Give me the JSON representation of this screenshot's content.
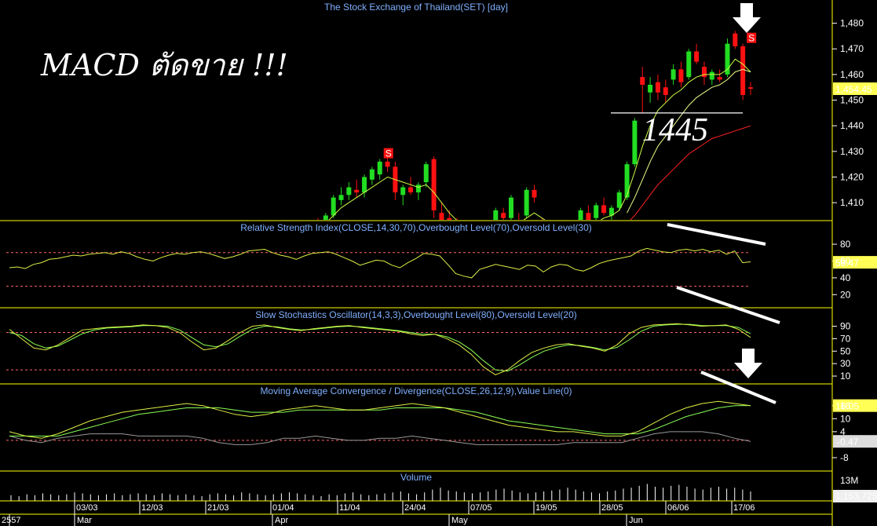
{
  "annotations": {
    "headline": "MACD ตัดขาย !!!",
    "support_label": "1445",
    "sell_marker": "S"
  },
  "colors": {
    "up": "#22dd22",
    "down": "#ff1111",
    "ma_fast": "#ccff44",
    "ma_slow": "#ff2222",
    "osc_main": "#ddee44",
    "osc_signal": "#88ff55",
    "macd_hist": "#999999",
    "level_line": "#ff6666",
    "panel_border": "#ffff00",
    "title": "#7fb0ff",
    "last_value_bg": "#ffff55"
  },
  "chart_data": [
    {
      "type": "candlestick",
      "title": "The Stock Exchange of Thailand(SET) [day]",
      "ylim": [
        1403,
        1486
      ],
      "yticks": [
        1410,
        1420,
        1430,
        1440,
        1450,
        1460,
        1470,
        1480
      ],
      "last_value": "1,454.45",
      "dates": [
        "03/03",
        "12/03",
        "21/03",
        "01/04",
        "11/04",
        "24/04",
        "07/05",
        "19/05",
        "28/05",
        "06/06",
        "17/06"
      ],
      "candles": [
        {
          "o": 1402,
          "h": 1404,
          "l": 1400,
          "c": 1401
        },
        {
          "o": 1403,
          "h": 1406,
          "l": 1401,
          "c": 1405
        },
        {
          "o": 1405,
          "h": 1413,
          "l": 1404,
          "c": 1412
        },
        {
          "o": 1411,
          "h": 1416,
          "l": 1409,
          "c": 1413
        },
        {
          "o": 1413,
          "h": 1418,
          "l": 1411,
          "c": 1416
        },
        {
          "o": 1415,
          "h": 1419,
          "l": 1412,
          "c": 1414
        },
        {
          "o": 1414,
          "h": 1421,
          "l": 1412,
          "c": 1420
        },
        {
          "o": 1419,
          "h": 1424,
          "l": 1417,
          "c": 1423
        },
        {
          "o": 1421,
          "h": 1427,
          "l": 1419,
          "c": 1426
        },
        {
          "o": 1426,
          "h": 1428,
          "l": 1422,
          "c": 1424
        },
        {
          "o": 1424,
          "h": 1426,
          "l": 1411,
          "c": 1414
        },
        {
          "o": 1413,
          "h": 1417,
          "l": 1409,
          "c": 1416
        },
        {
          "o": 1416,
          "h": 1420,
          "l": 1413,
          "c": 1414
        },
        {
          "o": 1414,
          "h": 1418,
          "l": 1411,
          "c": 1417
        },
        {
          "o": 1418,
          "h": 1426,
          "l": 1416,
          "c": 1425
        },
        {
          "o": 1427,
          "h": 1428,
          "l": 1404,
          "c": 1407
        },
        {
          "o": 1406,
          "h": 1410,
          "l": 1400,
          "c": 1403
        },
        {
          "o": 1404,
          "h": 1407,
          "l": 1401,
          "c": 1402
        },
        {
          "o": 1401,
          "h": 1404,
          "l": 1399,
          "c": 1400
        },
        {
          "o": 1401,
          "h": 1403,
          "l": 1398,
          "c": 1399
        },
        {
          "o": 1400,
          "h": 1402,
          "l": 1398,
          "c": 1399
        },
        {
          "o": 1399,
          "h": 1401,
          "l": 1397,
          "c": 1398
        },
        {
          "o": 1398,
          "h": 1400,
          "l": 1396,
          "c": 1397
        },
        {
          "o": 1398,
          "h": 1408,
          "l": 1397,
          "c": 1407
        },
        {
          "o": 1406,
          "h": 1408,
          "l": 1402,
          "c": 1404
        },
        {
          "o": 1404,
          "h": 1413,
          "l": 1403,
          "c": 1412
        },
        {
          "o": 1403,
          "h": 1406,
          "l": 1401,
          "c": 1402
        },
        {
          "o": 1405,
          "h": 1416,
          "l": 1404,
          "c": 1415
        },
        {
          "o": 1415,
          "h": 1417,
          "l": 1410,
          "c": 1412
        },
        {
          "o": 1402,
          "h": 1404,
          "l": 1400,
          "c": 1401
        },
        {
          "o": 1400,
          "h": 1403,
          "l": 1398,
          "c": 1399
        },
        {
          "o": 1399,
          "h": 1402,
          "l": 1397,
          "c": 1398
        },
        {
          "o": 1398,
          "h": 1400,
          "l": 1396,
          "c": 1397
        },
        {
          "o": 1397,
          "h": 1399,
          "l": 1395,
          "c": 1396
        },
        {
          "o": 1402,
          "h": 1408,
          "l": 1400,
          "c": 1407
        },
        {
          "o": 1406,
          "h": 1409,
          "l": 1402,
          "c": 1403
        },
        {
          "o": 1404,
          "h": 1410,
          "l": 1403,
          "c": 1409
        },
        {
          "o": 1409,
          "h": 1412,
          "l": 1405,
          "c": 1406
        },
        {
          "o": 1405,
          "h": 1409,
          "l": 1402,
          "c": 1408
        },
        {
          "o": 1408,
          "h": 1415,
          "l": 1407,
          "c": 1414
        },
        {
          "o": 1412,
          "h": 1426,
          "l": 1411,
          "c": 1425
        },
        {
          "o": 1425,
          "h": 1443,
          "l": 1424,
          "c": 1442
        },
        {
          "o": 1459,
          "h": 1463,
          "l": 1445,
          "c": 1456
        },
        {
          "o": 1453,
          "h": 1459,
          "l": 1449,
          "c": 1456
        },
        {
          "o": 1457,
          "h": 1460,
          "l": 1450,
          "c": 1453
        },
        {
          "o": 1455,
          "h": 1458,
          "l": 1449,
          "c": 1452
        },
        {
          "o": 1458,
          "h": 1464,
          "l": 1456,
          "c": 1462
        },
        {
          "o": 1462,
          "h": 1465,
          "l": 1455,
          "c": 1457
        },
        {
          "o": 1459,
          "h": 1470,
          "l": 1458,
          "c": 1469
        },
        {
          "o": 1469,
          "h": 1472,
          "l": 1464,
          "c": 1465
        },
        {
          "o": 1463,
          "h": 1465,
          "l": 1456,
          "c": 1459
        },
        {
          "o": 1458,
          "h": 1462,
          "l": 1456,
          "c": 1461
        },
        {
          "o": 1459,
          "h": 1462,
          "l": 1457,
          "c": 1458
        },
        {
          "o": 1460,
          "h": 1474,
          "l": 1459,
          "c": 1472
        },
        {
          "o": 1476,
          "h": 1477,
          "l": 1470,
          "c": 1471
        },
        {
          "o": 1471,
          "h": 1472,
          "l": 1450,
          "c": 1452
        },
        {
          "o": 1455,
          "h": 1457,
          "l": 1452,
          "c": 1454.45
        }
      ],
      "sell_signal_bars": [
        8,
        55
      ],
      "ma_fast": [
        1400,
        1402,
        1405,
        1408,
        1410,
        1412,
        1414,
        1416,
        1418,
        1420,
        1419,
        1418,
        1417,
        1416,
        1417,
        1414,
        1410,
        1406,
        1403,
        1401,
        1400,
        1399,
        1398,
        1399,
        1400,
        1402,
        1402,
        1404,
        1406,
        1404,
        1402,
        1400,
        1398,
        1397,
        1399,
        1400,
        1402,
        1404,
        1405,
        1407,
        1413,
        1422,
        1432,
        1440,
        1446,
        1449,
        1452,
        1454,
        1457,
        1459,
        1460,
        1460,
        1460,
        1462,
        1466,
        1464,
        1461
      ],
      "ma_slow": [
        null,
        null,
        null,
        null,
        null,
        null,
        null,
        null,
        null,
        null,
        null,
        null,
        null,
        null,
        null,
        null,
        null,
        null,
        null,
        null,
        null,
        null,
        null,
        null,
        null,
        null,
        null,
        null,
        null,
        null,
        null,
        null,
        null,
        null,
        null,
        null,
        null,
        null,
        null,
        null,
        1402,
        1405,
        1409,
        1413,
        1417,
        1420,
        1423,
        1426,
        1429,
        1431,
        1433,
        1435,
        1436,
        1437,
        1438,
        1439,
        1440
      ],
      "ma_fast2": [
        null,
        null,
        null,
        null,
        null,
        null,
        null,
        null,
        null,
        null,
        null,
        null,
        null,
        null,
        null,
        null,
        null,
        null,
        null,
        null,
        null,
        null,
        null,
        null,
        null,
        null,
        null,
        null,
        null,
        null,
        null,
        null,
        null,
        null,
        null,
        null,
        null,
        null,
        null,
        null,
        1406,
        1412,
        1419,
        1426,
        1432,
        1436,
        1440,
        1444,
        1448,
        1451,
        1453,
        1455,
        1456,
        1458,
        1461,
        1462,
        1461
      ]
    },
    {
      "type": "line",
      "title": "Relative Strength Index(CLOSE,14,30,70),Overbought Level(70),Oversold Level(30)",
      "ylim": [
        10,
        95
      ],
      "yticks": [
        20,
        40,
        60,
        80
      ],
      "levels": [
        70,
        30
      ],
      "last_value": "58.47",
      "values": [
        52,
        53,
        51,
        56,
        58,
        62,
        63,
        65,
        67,
        66,
        68,
        69,
        70,
        68,
        71,
        69,
        65,
        62,
        60,
        64,
        67,
        69,
        68,
        70,
        71,
        69,
        66,
        63,
        65,
        68,
        72,
        73,
        74,
        70,
        67,
        65,
        62,
        66,
        69,
        70,
        71,
        68,
        64,
        60,
        55,
        58,
        61,
        60,
        55,
        52,
        58,
        63,
        69,
        68,
        66,
        56,
        45,
        42,
        40,
        50,
        53,
        56,
        54,
        52,
        50,
        55,
        54,
        47,
        53,
        56,
        55,
        50,
        48,
        52,
        57,
        60,
        62,
        64,
        66,
        72,
        75,
        73,
        71,
        70,
        73,
        74,
        72,
        74,
        71,
        73,
        68,
        72,
        58,
        59
      ]
    },
    {
      "type": "line",
      "title": "Slow Stochastics Oscillator(14,3,3),Overbought Level(80),Oversold Level(20)",
      "ylim": [
        5,
        102
      ],
      "yticks": [
        10,
        30,
        50,
        70,
        90
      ],
      "levels": [
        80,
        20
      ],
      "main": [
        85,
        70,
        55,
        52,
        60,
        72,
        84,
        86,
        88,
        89,
        90,
        92,
        91,
        88,
        80,
        65,
        52,
        55,
        67,
        80,
        90,
        92,
        88,
        85,
        83,
        86,
        88,
        90,
        91,
        88,
        86,
        84,
        82,
        78,
        75,
        77,
        70,
        60,
        45,
        25,
        12,
        20,
        35,
        48,
        55,
        60,
        62,
        58,
        55,
        50,
        60,
        78,
        88,
        92,
        93,
        94,
        92,
        90,
        91,
        92,
        85,
        72
      ],
      "signal": [
        80,
        75,
        62,
        55,
        58,
        68,
        78,
        84,
        87,
        88,
        89,
        91,
        91,
        90,
        84,
        72,
        60,
        57,
        62,
        74,
        85,
        90,
        89,
        86,
        84,
        85,
        87,
        89,
        90,
        89,
        87,
        85,
        83,
        80,
        77,
        77,
        73,
        65,
        52,
        35,
        20,
        18,
        28,
        40,
        50,
        56,
        60,
        59,
        56,
        52,
        56,
        68,
        82,
        90,
        92,
        93,
        93,
        91,
        91,
        91,
        88,
        78
      ]
    },
    {
      "type": "line",
      "title": "Moving Average Convergence / Divergence(CLOSE,26,12,9),Value Line(0)",
      "ylim": [
        -12,
        21
      ],
      "yticks": [
        -8,
        4,
        10,
        16
      ],
      "levels": [
        0
      ],
      "last_value": "16.05",
      "last_value_hist": "-0.47",
      "macd": [
        4,
        2,
        1,
        3,
        6,
        9,
        11,
        13,
        14,
        15,
        16,
        17,
        16,
        14,
        12,
        11,
        12,
        14,
        15,
        16,
        15,
        14,
        14,
        15,
        16,
        17,
        16,
        15,
        13,
        11,
        9,
        7,
        6,
        5,
        4,
        4,
        3,
        2,
        2,
        4,
        8,
        12,
        15,
        17,
        18,
        17,
        16
      ],
      "signal": [
        2,
        2,
        2,
        2,
        4,
        6,
        8,
        10,
        12,
        13,
        14,
        15,
        15,
        15,
        14,
        13,
        13,
        13,
        14,
        14,
        14,
        14,
        14,
        14,
        15,
        15,
        15,
        15,
        14,
        13,
        11,
        9,
        8,
        7,
        6,
        5,
        4,
        3,
        3,
        3,
        5,
        8,
        11,
        13,
        15,
        16,
        16.05
      ],
      "hist": [
        2,
        0,
        -1,
        1,
        2,
        3,
        3,
        3,
        2,
        2,
        2,
        2,
        1,
        -1,
        -2,
        -2,
        -1,
        1,
        1,
        2,
        1,
        0,
        0,
        1,
        1,
        2,
        1,
        0,
        -1,
        -2,
        -2,
        -2,
        -2,
        -2,
        -2,
        -1,
        -1,
        -1,
        -1,
        1,
        3,
        4,
        4,
        4,
        3,
        1,
        -0.47
      ]
    },
    {
      "type": "bar",
      "title": "Volume",
      "yticks_label": "13M",
      "last_value": "1,153,725",
      "values": [
        6,
        5,
        7,
        6,
        8,
        7,
        6,
        7,
        9,
        8,
        7,
        6,
        7,
        8,
        6,
        7,
        8,
        7,
        6,
        8,
        7,
        6,
        7,
        6,
        5,
        7,
        8,
        7,
        6,
        9,
        8,
        7,
        6,
        7,
        8,
        9,
        8,
        7,
        6,
        5,
        7,
        6,
        8,
        9,
        7,
        6,
        7,
        8,
        9,
        10,
        8,
        7,
        9,
        12,
        14,
        11,
        10,
        9,
        8,
        9,
        10,
        12,
        13,
        11,
        9,
        8,
        9,
        10,
        11,
        12,
        14,
        12,
        10,
        9,
        8,
        10,
        11,
        13,
        14,
        16,
        18,
        15,
        14,
        16,
        17,
        15,
        13,
        12,
        14,
        15,
        13,
        14,
        12,
        10
      ]
    }
  ],
  "time_axis": {
    "year": "2557",
    "months": [
      "Mar",
      "Apr",
      "May",
      "Jun"
    ]
  }
}
